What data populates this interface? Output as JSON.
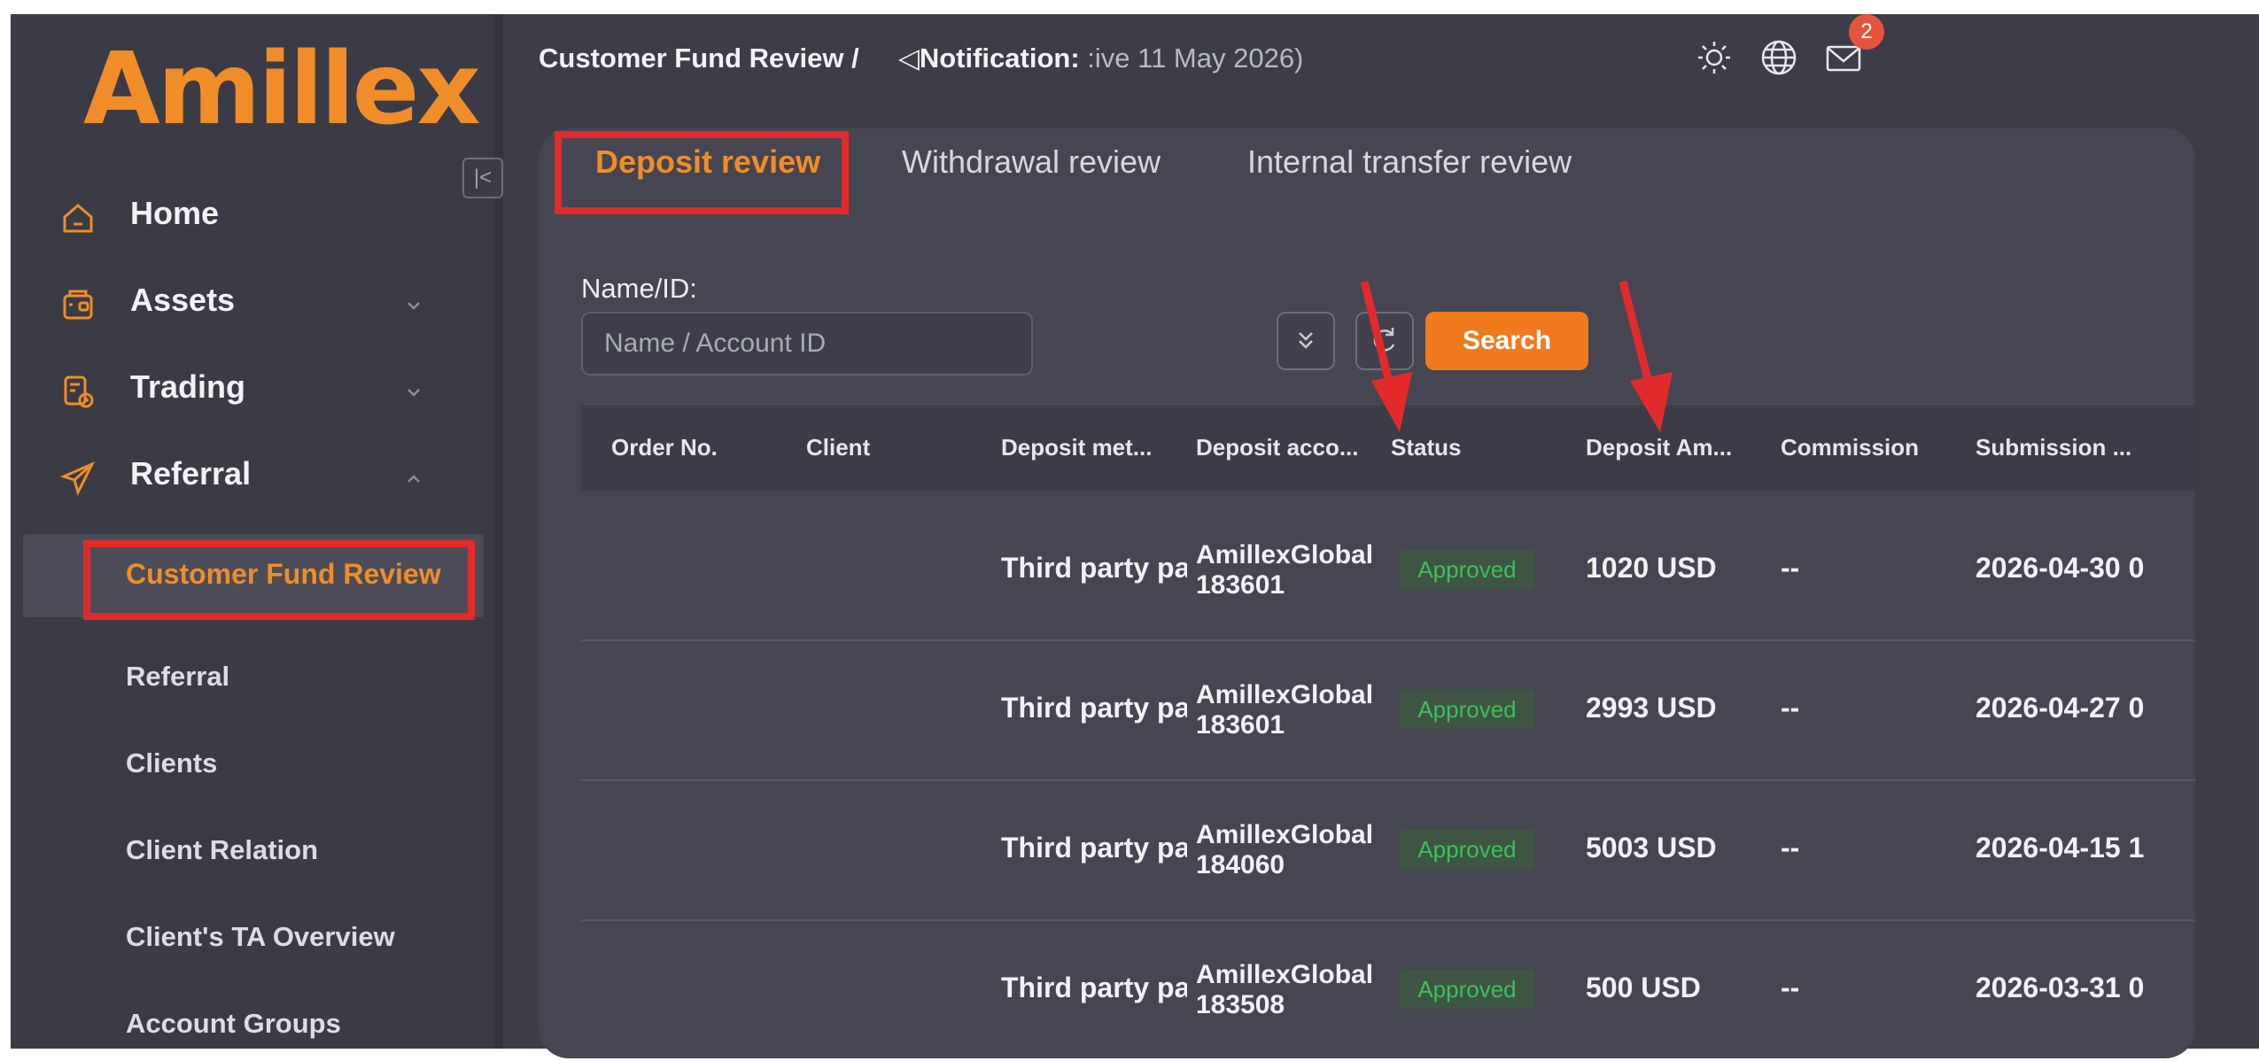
{
  "brand": {
    "logo_text": "Amillex",
    "accent": "#f08d29"
  },
  "sidebar": {
    "items": [
      {
        "label": "Home",
        "icon": "home-icon"
      },
      {
        "label": "Assets",
        "icon": "wallet-icon"
      },
      {
        "label": "Trading",
        "icon": "trading-icon"
      },
      {
        "label": "Referral",
        "icon": "paper-plane-icon"
      }
    ],
    "submenu": [
      {
        "label": "Customer Fund Review",
        "active": true
      },
      {
        "label": "Referral"
      },
      {
        "label": "Clients"
      },
      {
        "label": "Client Relation"
      },
      {
        "label": "Client's TA Overview"
      },
      {
        "label": "Account Groups"
      }
    ]
  },
  "header": {
    "breadcrumb": "Customer Fund Review /",
    "notification_label": "Notification:",
    "notification_text": " :ive 11 May 2026)",
    "mail_badge": "2",
    "icons": [
      "sun-icon",
      "globe-icon",
      "mail-icon"
    ]
  },
  "tabs": [
    {
      "label": "Deposit review",
      "active": true
    },
    {
      "label": "Withdrawal review"
    },
    {
      "label": "Internal transfer review"
    }
  ],
  "filter": {
    "label": "Name/ID:",
    "placeholder": "Name / Account ID",
    "value": "",
    "search_label": "Search"
  },
  "table": {
    "columns": [
      "Order No.",
      "Client",
      "Deposit met...",
      "Deposit acco...",
      "Status",
      "Deposit Am...",
      "Commission",
      "Submission ..."
    ],
    "rows": [
      {
        "order_no": "",
        "client": "",
        "method": "Third party pa",
        "account_name": "AmillexGlobal",
        "account_no": "183601",
        "status": "Approved",
        "amount": "1020 USD",
        "commission": "--",
        "submitted": "2026-04-30 0"
      },
      {
        "order_no": "",
        "client": "",
        "method": "Third party pa",
        "account_name": "AmillexGlobal",
        "account_no": "183601",
        "status": "Approved",
        "amount": "2993 USD",
        "commission": "--",
        "submitted": "2026-04-27 0"
      },
      {
        "order_no": "",
        "client": "",
        "method": "Third party pa",
        "account_name": "AmillexGlobal",
        "account_no": "184060",
        "status": "Approved",
        "amount": "5003 USD",
        "commission": "--",
        "submitted": "2026-04-15 1"
      },
      {
        "order_no": "",
        "client": "",
        "method": "Third party pa",
        "account_name": "AmillexGlobal",
        "account_no": "183508",
        "status": "Approved",
        "amount": "500 USD",
        "commission": "--",
        "submitted": "2026-03-31 0"
      }
    ]
  },
  "colors": {
    "status_approved": "#3fc05a",
    "annotation": "#e32a2a",
    "search_button": "#f07a1c"
  }
}
